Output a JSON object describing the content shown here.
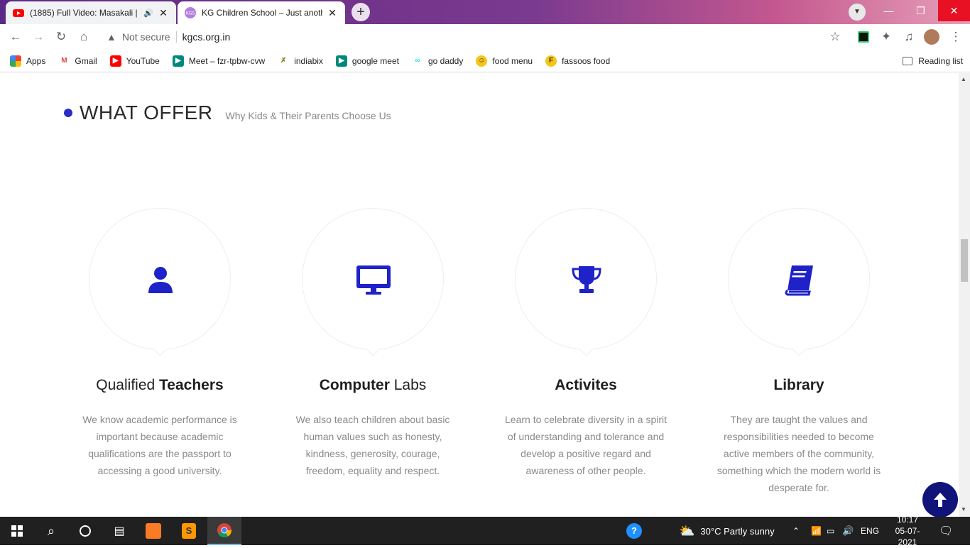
{
  "browser": {
    "tabs": [
      {
        "title": "(1885) Full Video: Masakali | Delhi-6",
        "favicon": "youtube-icon",
        "audio": true
      },
      {
        "title": "KG Children School – Just another WordPress site",
        "favicon": "kgs-icon",
        "active": true
      }
    ],
    "address": {
      "security": "Not secure",
      "url": "kgcs.org.in"
    },
    "bookmarks": [
      {
        "label": "Apps",
        "icon": "apps-grid-icon"
      },
      {
        "label": "Gmail",
        "icon": "gmail-icon"
      },
      {
        "label": "YouTube",
        "icon": "youtube-icon"
      },
      {
        "label": "Meet – fzr-tpbw-cvw",
        "icon": "meet-icon"
      },
      {
        "label": "indiabix",
        "icon": "indiabix-icon"
      },
      {
        "label": "google meet",
        "icon": "meet-icon"
      },
      {
        "label": "go daddy",
        "icon": "godaddy-icon"
      },
      {
        "label": "food menu",
        "icon": "food-icon"
      },
      {
        "label": "fassoos food",
        "icon": "faasos-icon"
      }
    ],
    "reading_list": "Reading list"
  },
  "section": {
    "title": "WHAT OFFER",
    "subtitle": "Why Kids & Their Parents Choose Us",
    "accent": "#2a2ec7"
  },
  "features": [
    {
      "title_light": "Qualified ",
      "title_bold": "Teachers",
      "desc": "We know academic performance is important because academic qualifications are the passport to accessing a good university.",
      "icon": "user-icon"
    },
    {
      "title_bold": "Computer",
      "title_light": " Labs",
      "desc": "We also teach children about basic human values such as honesty, kindness, generosity, courage, freedom, equality and respect.",
      "icon": "monitor-icon"
    },
    {
      "title_bold": "Activites",
      "title_light": "",
      "desc": "Learn to celebrate diversity in a spirit of understanding and tolerance and develop a positive regard and awareness of other people.",
      "icon": "trophy-icon"
    },
    {
      "title_bold": "Library",
      "title_light": "",
      "desc": "They are taught the values and responsibilities needed to become active members of the community, something which the modern world is desperate for.",
      "icon": "book-icon"
    }
  ],
  "taskbar": {
    "weather": "30°C  Partly sunny",
    "lang": "ENG",
    "time": "10:17",
    "date": "05-07-2021"
  }
}
